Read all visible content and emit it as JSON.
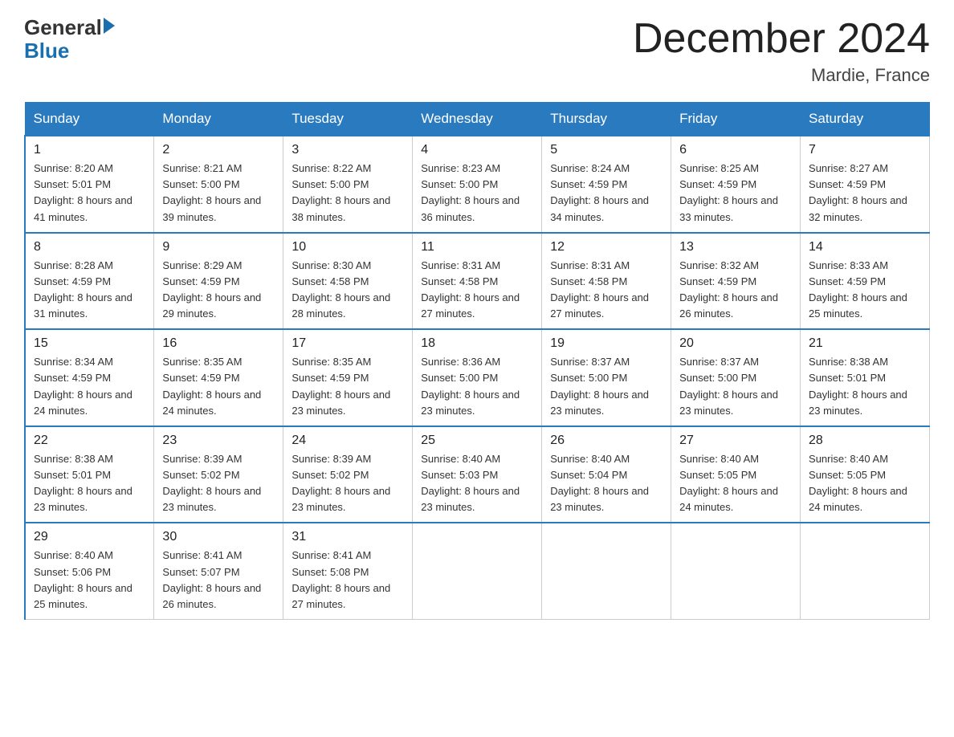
{
  "header": {
    "logo_general": "General",
    "logo_blue": "Blue",
    "month_title": "December 2024",
    "location": "Mardie, France"
  },
  "days_of_week": [
    "Sunday",
    "Monday",
    "Tuesday",
    "Wednesday",
    "Thursday",
    "Friday",
    "Saturday"
  ],
  "weeks": [
    [
      {
        "day": "1",
        "sunrise": "8:20 AM",
        "sunset": "5:01 PM",
        "daylight": "8 hours and 41 minutes."
      },
      {
        "day": "2",
        "sunrise": "8:21 AM",
        "sunset": "5:00 PM",
        "daylight": "8 hours and 39 minutes."
      },
      {
        "day": "3",
        "sunrise": "8:22 AM",
        "sunset": "5:00 PM",
        "daylight": "8 hours and 38 minutes."
      },
      {
        "day": "4",
        "sunrise": "8:23 AM",
        "sunset": "5:00 PM",
        "daylight": "8 hours and 36 minutes."
      },
      {
        "day": "5",
        "sunrise": "8:24 AM",
        "sunset": "4:59 PM",
        "daylight": "8 hours and 34 minutes."
      },
      {
        "day": "6",
        "sunrise": "8:25 AM",
        "sunset": "4:59 PM",
        "daylight": "8 hours and 33 minutes."
      },
      {
        "day": "7",
        "sunrise": "8:27 AM",
        "sunset": "4:59 PM",
        "daylight": "8 hours and 32 minutes."
      }
    ],
    [
      {
        "day": "8",
        "sunrise": "8:28 AM",
        "sunset": "4:59 PM",
        "daylight": "8 hours and 31 minutes."
      },
      {
        "day": "9",
        "sunrise": "8:29 AM",
        "sunset": "4:59 PM",
        "daylight": "8 hours and 29 minutes."
      },
      {
        "day": "10",
        "sunrise": "8:30 AM",
        "sunset": "4:58 PM",
        "daylight": "8 hours and 28 minutes."
      },
      {
        "day": "11",
        "sunrise": "8:31 AM",
        "sunset": "4:58 PM",
        "daylight": "8 hours and 27 minutes."
      },
      {
        "day": "12",
        "sunrise": "8:31 AM",
        "sunset": "4:58 PM",
        "daylight": "8 hours and 27 minutes."
      },
      {
        "day": "13",
        "sunrise": "8:32 AM",
        "sunset": "4:59 PM",
        "daylight": "8 hours and 26 minutes."
      },
      {
        "day": "14",
        "sunrise": "8:33 AM",
        "sunset": "4:59 PM",
        "daylight": "8 hours and 25 minutes."
      }
    ],
    [
      {
        "day": "15",
        "sunrise": "8:34 AM",
        "sunset": "4:59 PM",
        "daylight": "8 hours and 24 minutes."
      },
      {
        "day": "16",
        "sunrise": "8:35 AM",
        "sunset": "4:59 PM",
        "daylight": "8 hours and 24 minutes."
      },
      {
        "day": "17",
        "sunrise": "8:35 AM",
        "sunset": "4:59 PM",
        "daylight": "8 hours and 23 minutes."
      },
      {
        "day": "18",
        "sunrise": "8:36 AM",
        "sunset": "5:00 PM",
        "daylight": "8 hours and 23 minutes."
      },
      {
        "day": "19",
        "sunrise": "8:37 AM",
        "sunset": "5:00 PM",
        "daylight": "8 hours and 23 minutes."
      },
      {
        "day": "20",
        "sunrise": "8:37 AM",
        "sunset": "5:00 PM",
        "daylight": "8 hours and 23 minutes."
      },
      {
        "day": "21",
        "sunrise": "8:38 AM",
        "sunset": "5:01 PM",
        "daylight": "8 hours and 23 minutes."
      }
    ],
    [
      {
        "day": "22",
        "sunrise": "8:38 AM",
        "sunset": "5:01 PM",
        "daylight": "8 hours and 23 minutes."
      },
      {
        "day": "23",
        "sunrise": "8:39 AM",
        "sunset": "5:02 PM",
        "daylight": "8 hours and 23 minutes."
      },
      {
        "day": "24",
        "sunrise": "8:39 AM",
        "sunset": "5:02 PM",
        "daylight": "8 hours and 23 minutes."
      },
      {
        "day": "25",
        "sunrise": "8:40 AM",
        "sunset": "5:03 PM",
        "daylight": "8 hours and 23 minutes."
      },
      {
        "day": "26",
        "sunrise": "8:40 AM",
        "sunset": "5:04 PM",
        "daylight": "8 hours and 23 minutes."
      },
      {
        "day": "27",
        "sunrise": "8:40 AM",
        "sunset": "5:05 PM",
        "daylight": "8 hours and 24 minutes."
      },
      {
        "day": "28",
        "sunrise": "8:40 AM",
        "sunset": "5:05 PM",
        "daylight": "8 hours and 24 minutes."
      }
    ],
    [
      {
        "day": "29",
        "sunrise": "8:40 AM",
        "sunset": "5:06 PM",
        "daylight": "8 hours and 25 minutes."
      },
      {
        "day": "30",
        "sunrise": "8:41 AM",
        "sunset": "5:07 PM",
        "daylight": "8 hours and 26 minutes."
      },
      {
        "day": "31",
        "sunrise": "8:41 AM",
        "sunset": "5:08 PM",
        "daylight": "8 hours and 27 minutes."
      },
      null,
      null,
      null,
      null
    ]
  ]
}
